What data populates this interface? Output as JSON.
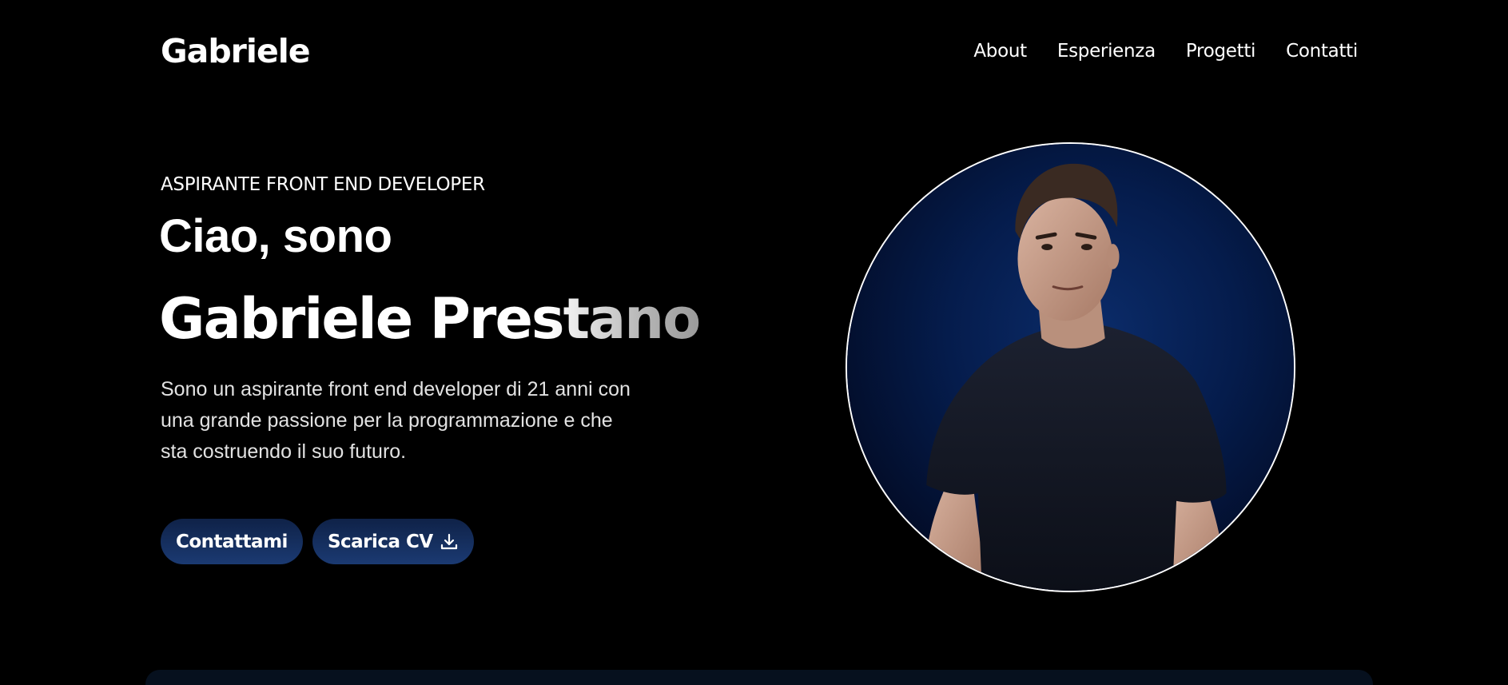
{
  "nav": {
    "brand": "Gabriele",
    "links": [
      "About",
      "Esperienza",
      "Progetti",
      "Contatti"
    ]
  },
  "hero": {
    "eyebrow": "ASPIRANTE FRONT END DEVELOPER",
    "greeting": "Ciao, sono",
    "name": "Gabriele Prestano",
    "bio": "Sono un aspirante front end developer di 21 anni con una grande passione per la programmazione e che sta costruendo il suo futuro.",
    "buttons": {
      "contact": "Contattami",
      "cv": "Scarica CV"
    }
  },
  "icons": {
    "cv_button_icon": "download-icon",
    "portrait": "profile-photo"
  },
  "colors": {
    "background": "#000000",
    "button_gradient_start": "#0f2248",
    "button_gradient_end": "#1b3a72",
    "portrait_background": "#041a48"
  }
}
